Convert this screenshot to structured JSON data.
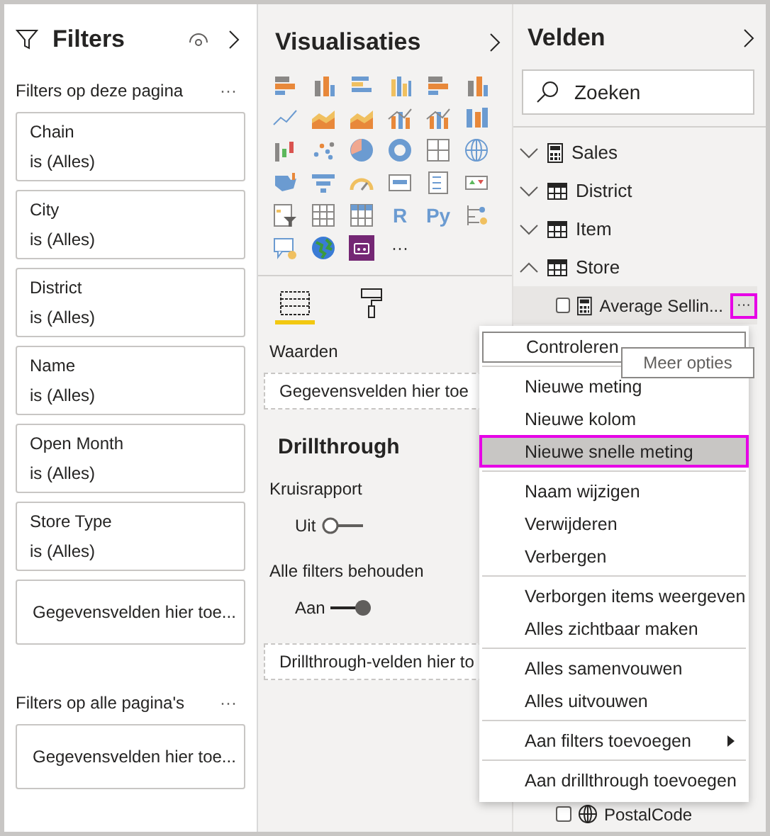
{
  "filters": {
    "title": "Filters",
    "page_section": {
      "title": "Filters op deze pagina",
      "more": "···",
      "cards": [
        {
          "field": "Chain",
          "condition": "is (Alles)"
        },
        {
          "field": "City",
          "condition": "is (Alles)"
        },
        {
          "field": "District",
          "condition": "is (Alles)"
        },
        {
          "field": "Name",
          "condition": "is (Alles)"
        },
        {
          "field": "Open Month",
          "condition": "is (Alles)"
        },
        {
          "field": "Store Type",
          "condition": "is (Alles)"
        }
      ],
      "drop_zone": "Gegevensvelden hier toe..."
    },
    "all_pages_section": {
      "title": "Filters op alle pagina's",
      "more": "···",
      "drop_zone": "Gegevensvelden hier toe..."
    }
  },
  "visualizations": {
    "title": "Visualisaties",
    "icons": [
      {
        "kind": "hbar"
      },
      {
        "kind": "vbar"
      },
      {
        "kind": "hbar2"
      },
      {
        "kind": "vbar2"
      },
      {
        "kind": "hbar"
      },
      {
        "kind": "vbar"
      },
      {
        "kind": "line"
      },
      {
        "kind": "area"
      },
      {
        "kind": "area"
      },
      {
        "kind": "combo"
      },
      {
        "kind": "combo"
      },
      {
        "kind": "ribbon"
      },
      {
        "kind": "waterfall"
      },
      {
        "kind": "scatter"
      },
      {
        "kind": "pie"
      },
      {
        "kind": "donut"
      },
      {
        "kind": "treemap"
      },
      {
        "kind": "globe"
      },
      {
        "kind": "filledmap"
      },
      {
        "kind": "funnel"
      },
      {
        "kind": "gauge"
      },
      {
        "kind": "card"
      },
      {
        "kind": "multicard"
      },
      {
        "kind": "kpi"
      },
      {
        "kind": "slicer"
      },
      {
        "kind": "table"
      },
      {
        "kind": "matrix"
      },
      {
        "kind": "letters",
        "label": "R"
      },
      {
        "kind": "letters",
        "label": "Py"
      },
      {
        "kind": "tree"
      },
      {
        "kind": "qa"
      },
      {
        "kind": "earth"
      },
      {
        "kind": "custom"
      },
      {
        "kind": "more",
        "label": "···"
      }
    ],
    "tabs": [
      {
        "kind": "fields",
        "selected": true
      },
      {
        "kind": "format",
        "selected": false
      }
    ],
    "values_label": "Waarden",
    "values_drop": "Gegevensvelden hier toe",
    "drillthrough": {
      "title": "Drillthrough",
      "cross_report": {
        "label": "Kruisrapport",
        "state": "Uit",
        "on": false
      },
      "keep_filters": {
        "label": "Alle filters behouden",
        "state": "Aan",
        "on": true
      },
      "drop": "Drillthrough-velden hier to"
    }
  },
  "fields": {
    "title": "Velden",
    "search": {
      "placeholder": "Zoeken"
    },
    "tables": [
      {
        "name": "Sales",
        "kind": "calculator",
        "expanded": false
      },
      {
        "name": "District",
        "kind": "table",
        "expanded": false
      },
      {
        "name": "Item",
        "kind": "table",
        "expanded": false
      },
      {
        "name": "Store",
        "kind": "table",
        "expanded": true,
        "children": [
          {
            "name": "Average Sellin...",
            "kind": "calculator",
            "checked": false,
            "selected": true
          },
          {
            "name": "PostalCode",
            "kind": "globe",
            "checked": false,
            "selected": false
          }
        ]
      }
    ]
  },
  "context_menu": {
    "groups": [
      [
        {
          "label": "Controleren",
          "kind": "item",
          "selected": false
        }
      ],
      [
        {
          "label": "Nieuwe meting",
          "kind": "item",
          "selected": false
        },
        {
          "label": "Nieuwe kolom",
          "kind": "item",
          "selected": false
        },
        {
          "label": "Nieuwe snelle meting",
          "kind": "item",
          "selected": true
        }
      ],
      [
        {
          "label": "Naam wijzigen",
          "kind": "item",
          "selected": false
        },
        {
          "label": "Verwijderen",
          "kind": "item",
          "selected": false
        },
        {
          "label": "Verbergen",
          "kind": "item",
          "selected": false
        }
      ],
      [
        {
          "label": "Verborgen items weergeven",
          "kind": "item",
          "selected": false
        },
        {
          "label": "Alles zichtbaar maken",
          "kind": "item",
          "selected": false
        }
      ],
      [
        {
          "label": "Alles samenvouwen",
          "kind": "item",
          "selected": false
        },
        {
          "label": "Alles uitvouwen",
          "kind": "item",
          "selected": false
        }
      ],
      [
        {
          "label": "Aan filters toevoegen",
          "kind": "submenu",
          "selected": false
        }
      ],
      [
        {
          "label": "Aan drillthrough toevoegen",
          "kind": "item",
          "selected": false
        }
      ]
    ]
  },
  "tooltip": "Meer opties"
}
